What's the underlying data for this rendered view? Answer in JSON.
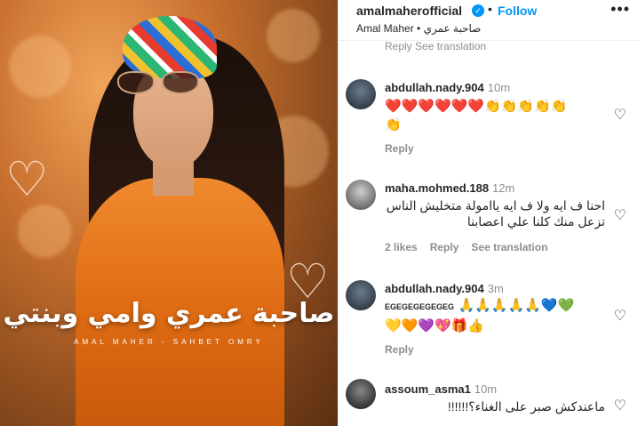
{
  "media": {
    "title_ar": "صاحبة عمري وامي وبنتي",
    "subtitle": "AMAL MAHER - SAHBET OMRY"
  },
  "header": {
    "username": "amalmaherofficial",
    "verified_icon": "✓",
    "separator": "•",
    "follow_label": "Follow",
    "more_icon": "•••",
    "subtitle": "Amal Maher • صاحبة عمري"
  },
  "ghost_actions": "Reply   See translation",
  "comments": [
    {
      "username": "abdullah.nady.904",
      "time": "10m",
      "emoji_line1": "❤️❤️❤️❤️❤️❤️👏👏👏👏👏",
      "emoji_line2": "👏",
      "actions": [
        "Reply"
      ]
    },
    {
      "username": "maha.mohmed.188",
      "time": "12m",
      "text": "احنا ف ايه ولا ف ايه ياامولة متخليش الناس تزعل منك كلنا علي اعصابنا",
      "actions": [
        "2 likes",
        "Reply",
        "See translation"
      ]
    },
    {
      "username": "abdullah.nady.904",
      "time": "3m",
      "text_prefix": "EGEGEGEGEGEG",
      "emoji_line1": "🙏🙏🙏🙏🙏💙💚",
      "emoji_line2": "💛🧡💜💖🎁👍",
      "actions": [
        "Reply"
      ]
    },
    {
      "username": "assoum_asma1",
      "time": "10m",
      "text": "ماعندكش صبر على الغناء؟!!!!!!",
      "actions": []
    }
  ],
  "like_icon": "♡"
}
